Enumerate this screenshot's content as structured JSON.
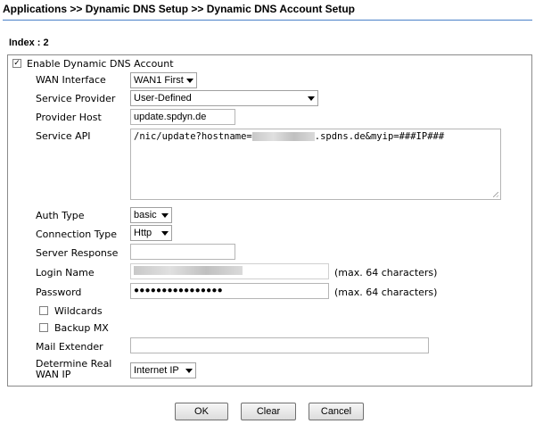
{
  "breadcrumb": "Applications >> Dynamic DNS Setup >> Dynamic DNS Account Setup",
  "index_label": "Index : 2",
  "enable_account": {
    "label": "Enable Dynamic DNS Account",
    "checked": true,
    "mark": "✓"
  },
  "wan_interface": {
    "label": "WAN Interface",
    "value": "WAN1 First"
  },
  "service_provider": {
    "label": "Service Provider",
    "value": "User-Defined"
  },
  "provider_host": {
    "label": "Provider Host",
    "value": "update.spdyn.de"
  },
  "service_api": {
    "label": "Service API",
    "value_prefix": "/nic/update?hostname=",
    "value_suffix": ".spdns.de&myip=###IP###"
  },
  "auth_type": {
    "label": "Auth Type",
    "value": "basic"
  },
  "connection_type": {
    "label": "Connection Type",
    "value": "Http"
  },
  "server_response": {
    "label": "Server Response",
    "value": ""
  },
  "login_name": {
    "label": "Login Name",
    "hint": "(max. 64 characters)"
  },
  "password": {
    "label": "Password",
    "value": "●●●●●●●●●●●●●●●●",
    "hint": "(max. 64 characters)"
  },
  "wildcards": {
    "label": "Wildcards",
    "checked": false
  },
  "backup_mx": {
    "label": "Backup MX",
    "checked": false
  },
  "mail_extender": {
    "label": "Mail Extender",
    "value": ""
  },
  "determine_wan_ip": {
    "label_line1": "Determine Real",
    "label_line2": "WAN IP",
    "value": "Internet IP"
  },
  "buttons": {
    "ok": "OK",
    "clear": "Clear",
    "cancel": "Cancel"
  }
}
